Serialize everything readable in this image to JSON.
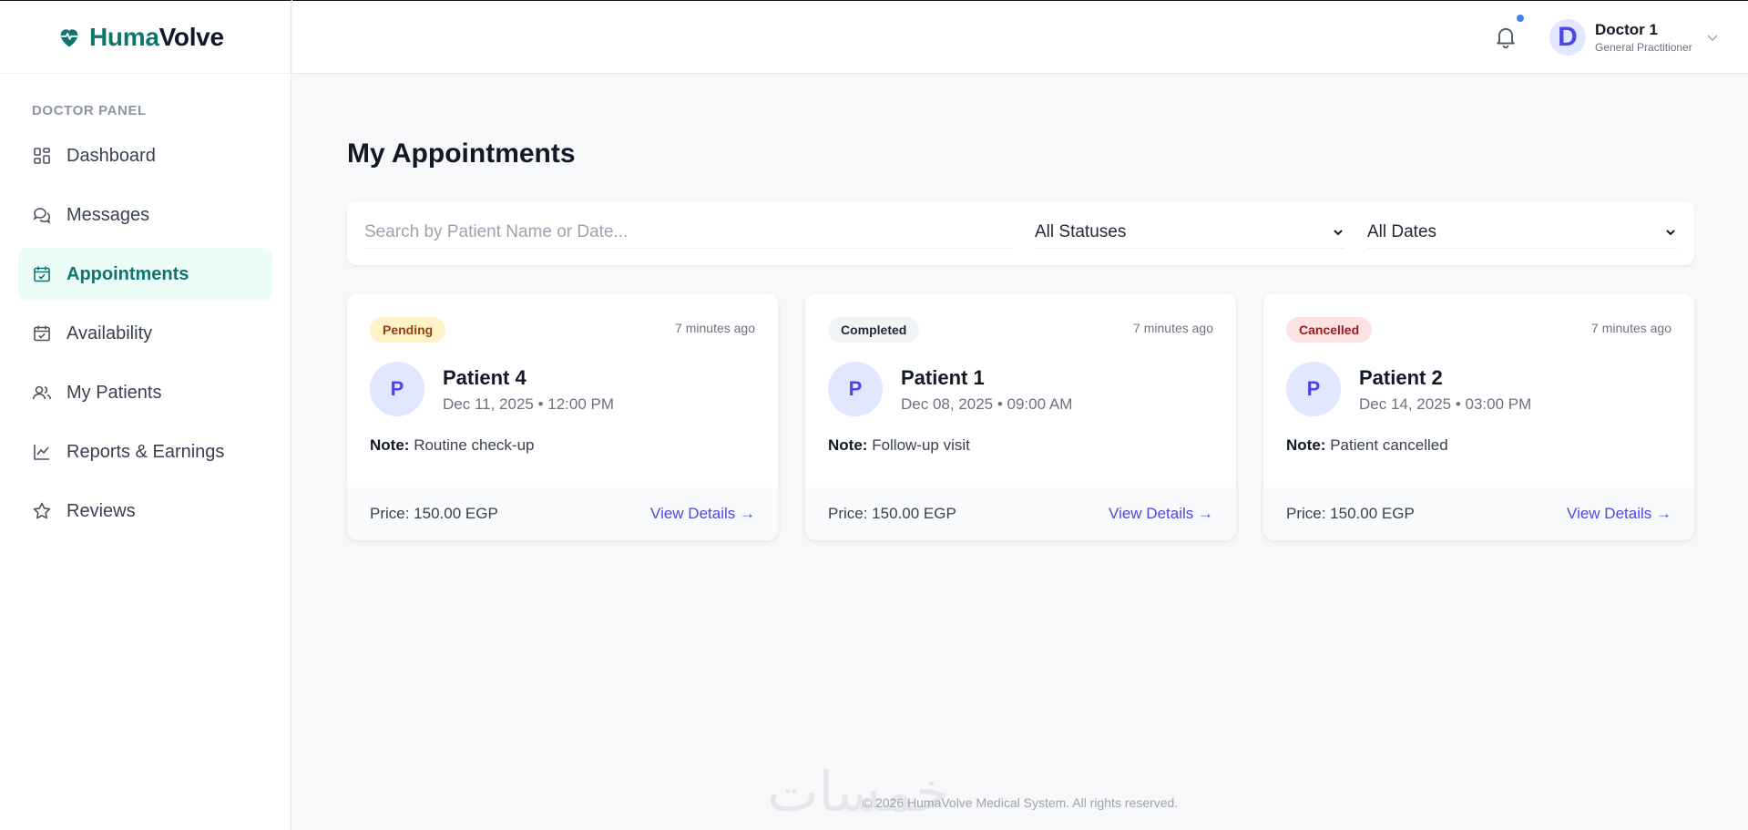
{
  "brand": {
    "part1": "Huma",
    "part2": "Volve"
  },
  "sidebar": {
    "panel_label": "DOCTOR PANEL",
    "items": [
      {
        "label": "Dashboard",
        "icon": "grid-icon",
        "active": false
      },
      {
        "label": "Messages",
        "icon": "chat-bubbles-icon",
        "active": false
      },
      {
        "label": "Appointments",
        "icon": "calendar-check-icon",
        "active": true
      },
      {
        "label": "Availability",
        "icon": "calendar-check-icon",
        "active": false
      },
      {
        "label": "My Patients",
        "icon": "users-icon",
        "active": false
      },
      {
        "label": "Reports & Earnings",
        "icon": "chart-line-icon",
        "active": false
      },
      {
        "label": "Reviews",
        "icon": "star-icon",
        "active": false
      }
    ]
  },
  "header": {
    "user_initial": "D",
    "user_name": "Doctor 1",
    "user_role": "General Practitioner"
  },
  "main": {
    "title": "My Appointments",
    "search_placeholder": "Search by Patient Name or Date...",
    "status_filter": "All Statuses",
    "date_filter": "All Dates"
  },
  "appointments": [
    {
      "status": "Pending",
      "time_ago": "7 minutes ago",
      "initial": "P",
      "patient": "Patient 4",
      "datetime": "Dec 11, 2025 • 12:00 PM",
      "note_label": "Note:",
      "note": "Routine check-up",
      "price": "Price: 150.00 EGP",
      "action": "View Details →"
    },
    {
      "status": "Completed",
      "time_ago": "7 minutes ago",
      "initial": "P",
      "patient": "Patient 1",
      "datetime": "Dec 08, 2025 • 09:00 AM",
      "note_label": "Note:",
      "note": "Follow-up visit",
      "price": "Price: 150.00 EGP",
      "action": "View Details →"
    },
    {
      "status": "Cancelled",
      "time_ago": "7 minutes ago",
      "initial": "P",
      "patient": "Patient 2",
      "datetime": "Dec 14, 2025 • 03:00 PM",
      "note_label": "Note:",
      "note": "Patient cancelled",
      "price": "Price: 150.00 EGP",
      "action": "View Details →"
    }
  ],
  "footer": {
    "text": "© 2026 HumaVolve Medical System. All rights reserved.",
    "watermark": "خمسات"
  },
  "colors": {
    "accent": "#0f766e",
    "link": "#4f46e5",
    "notification": "#3b82f6"
  }
}
